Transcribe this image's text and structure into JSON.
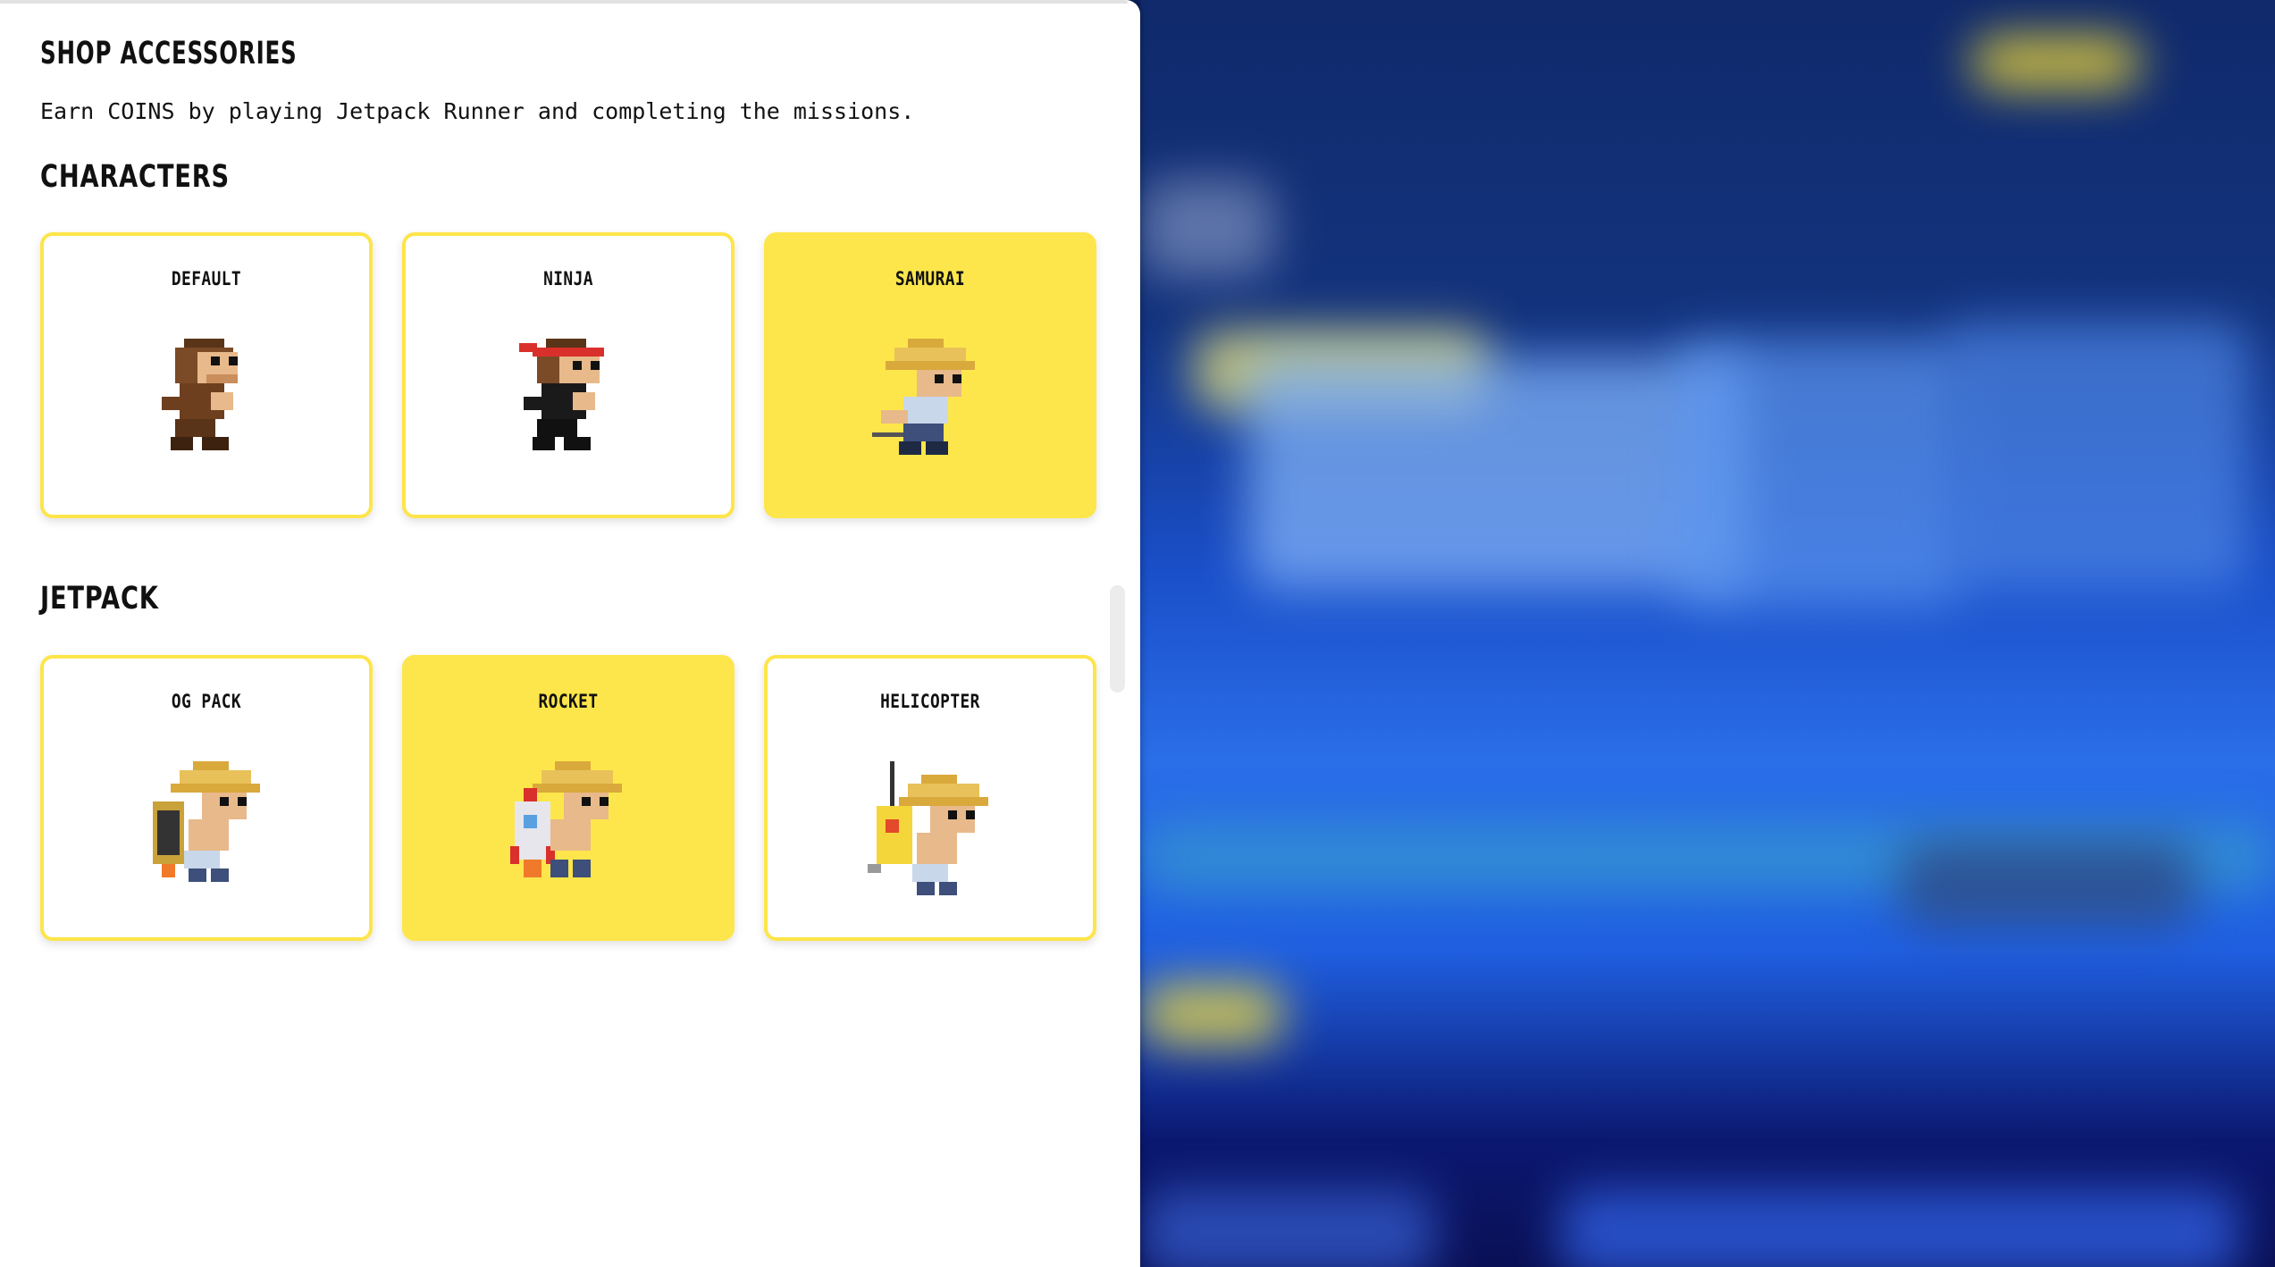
{
  "shop": {
    "title": "SHOP ACCESSORIES",
    "subtitle": "Earn COINS by playing Jetpack Runner and completing the missions."
  },
  "characters": {
    "heading": "CHARACTERS",
    "items": [
      {
        "label": "DEFAULT",
        "selected": false,
        "icon": "monkey-default-sprite"
      },
      {
        "label": "NINJA",
        "selected": false,
        "icon": "monkey-ninja-sprite"
      },
      {
        "label": "SAMURAI",
        "selected": true,
        "icon": "monkey-samurai-sprite"
      }
    ]
  },
  "jetpack": {
    "heading": "JETPACK",
    "items": [
      {
        "label": "OG PACK",
        "selected": false,
        "icon": "og-pack-sprite"
      },
      {
        "label": "ROCKET",
        "selected": true,
        "icon": "rocket-pack-sprite"
      },
      {
        "label": "HELICOPTER",
        "selected": false,
        "icon": "helicopter-pack-sprite"
      }
    ]
  },
  "colors": {
    "accent": "#fde64b",
    "text": "#111111",
    "panel": "#ffffff",
    "game_bg": "#1a4fc9"
  }
}
